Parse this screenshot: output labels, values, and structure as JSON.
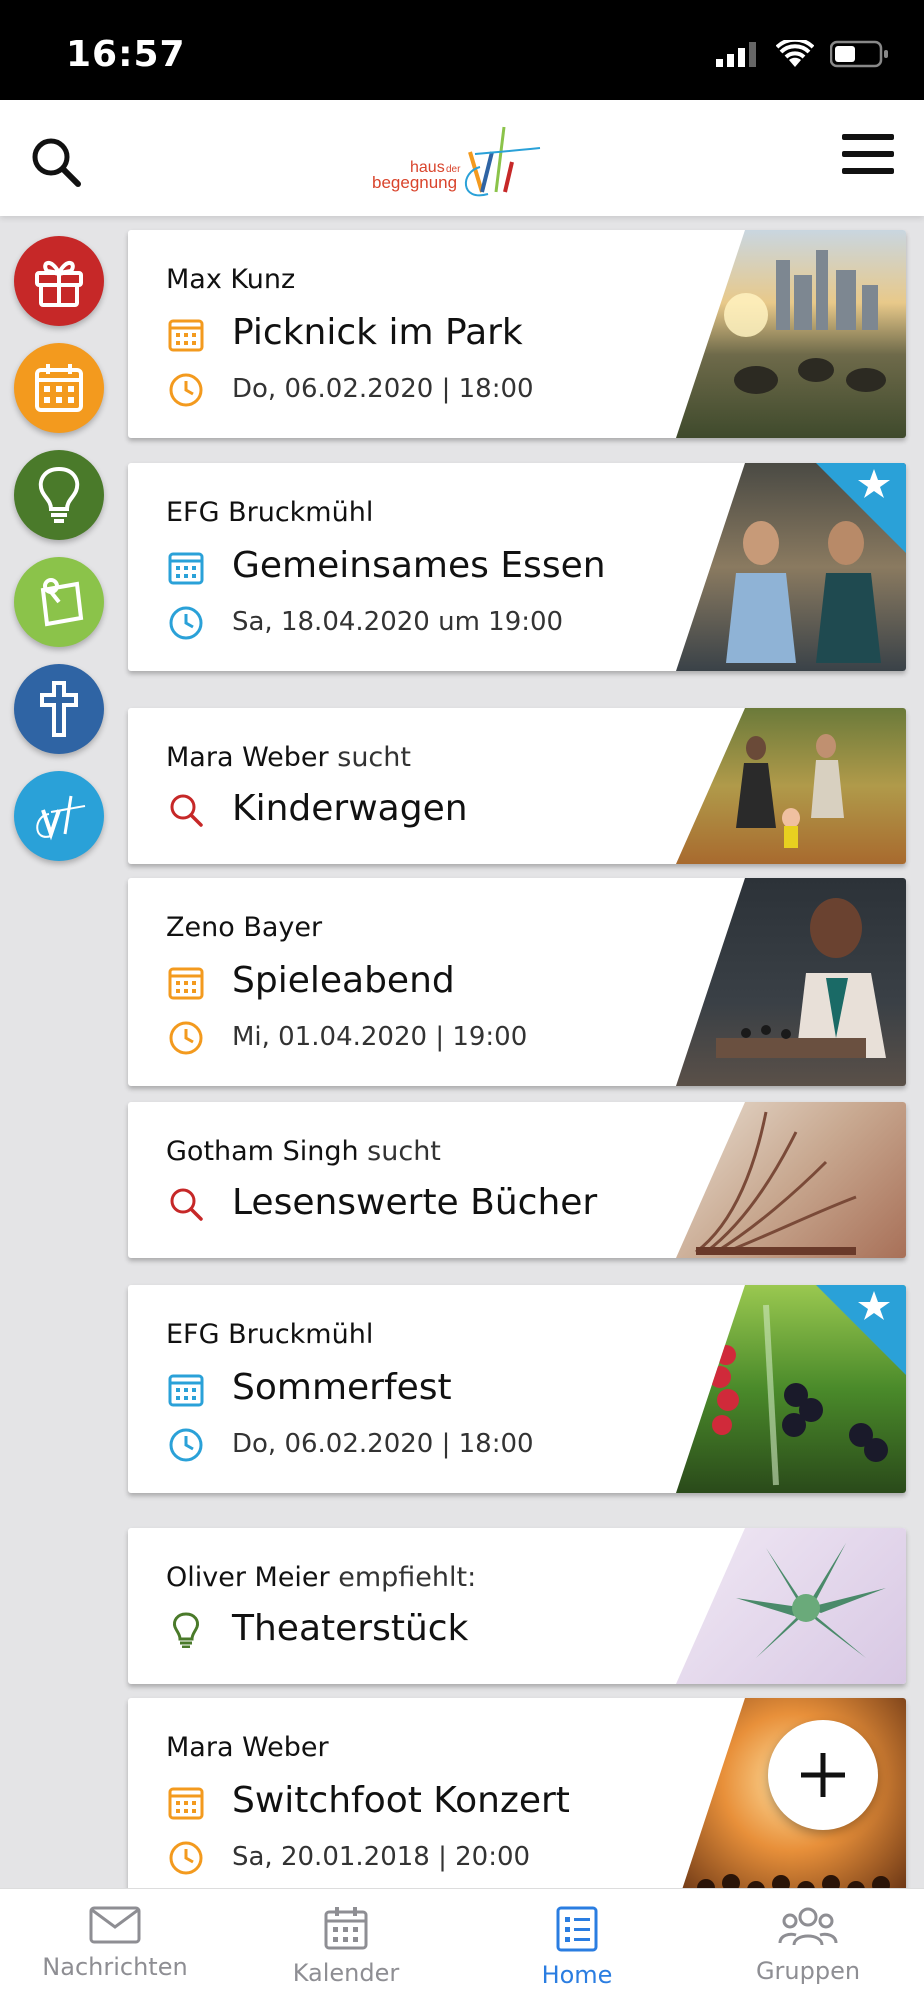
{
  "status": {
    "time": "16:57"
  },
  "nav": {
    "tabs": [
      {
        "label": "Nachrichten",
        "icon": "mail-icon"
      },
      {
        "label": "Kalender",
        "icon": "calendar-icon"
      },
      {
        "label": "Home",
        "icon": "list-icon"
      },
      {
        "label": "Gruppen",
        "icon": "group-icon"
      }
    ],
    "active_tab": "Home"
  },
  "logo": {
    "line1": "haus",
    "line1b": "der",
    "line2": "begegnung"
  },
  "rail": [
    {
      "icon": "gift-icon",
      "color": "#c62828"
    },
    {
      "icon": "calendar-icon",
      "color": "#f39a1e"
    },
    {
      "icon": "lightbulb-icon",
      "color": "#4a7a2a"
    },
    {
      "icon": "note-pin-icon",
      "color": "#8bc34a"
    },
    {
      "icon": "cross-icon",
      "color": "#2f64a4"
    },
    {
      "icon": "vf-logo-icon",
      "color": "#2aa1d8"
    }
  ],
  "cards": [
    {
      "author": "Max Kunz",
      "verb": "",
      "title": "Picknick im Park",
      "date": "Do, 06.02.2020 | 18:00",
      "type": "event",
      "accent": "#f39a1e",
      "featured": false
    },
    {
      "author": "EFG Bruckmühl",
      "verb": "",
      "title": "Gemeinsames Essen",
      "date": "Sa, 18.04.2020 um 19:00",
      "type": "event",
      "accent": "#2aa1d8",
      "featured": true
    },
    {
      "author": "Mara Weber",
      "verb": "sucht",
      "title": "Kinderwagen",
      "date": "",
      "type": "search",
      "accent": "#c62828",
      "featured": false
    },
    {
      "author": "Zeno Bayer",
      "verb": "",
      "title": "Spieleabend",
      "date": "Mi, 01.04.2020 | 19:00",
      "type": "event",
      "accent": "#f39a1e",
      "featured": false
    },
    {
      "author": "Gotham Singh",
      "verb": "sucht",
      "title": "Lesenswerte Bücher",
      "date": "",
      "type": "search",
      "accent": "#c62828",
      "featured": false
    },
    {
      "author": "EFG Bruckmühl",
      "verb": "",
      "title": "Sommerfest",
      "date": "Do, 06.02.2020 | 18:00",
      "type": "event",
      "accent": "#2aa1d8",
      "featured": true
    },
    {
      "author": "Oliver Meier",
      "verb": "empfiehlt:",
      "title": "Theaterstück",
      "date": "",
      "type": "tip",
      "accent": "#4a7a2a",
      "featured": false
    },
    {
      "author": "Mara Weber",
      "verb": "",
      "title": "Switchfoot Konzert",
      "date": "Sa, 20.01.2018 | 20:00",
      "type": "event",
      "accent": "#f39a1e",
      "featured": false
    }
  ],
  "fab": {
    "icon": "plus-icon"
  }
}
